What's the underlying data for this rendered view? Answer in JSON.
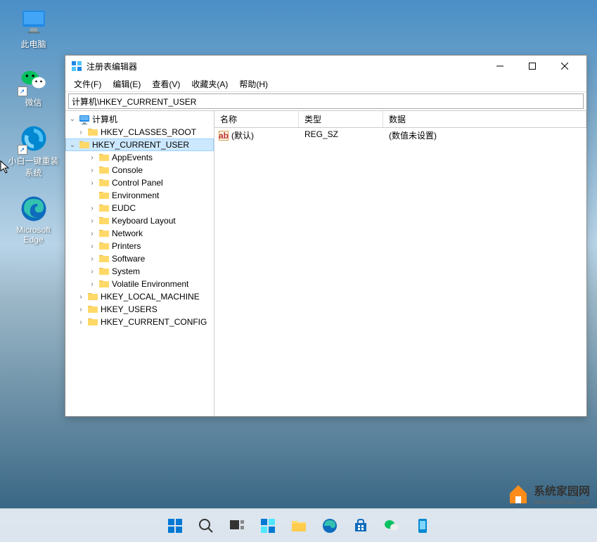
{
  "desktop": {
    "icons": [
      {
        "name": "pc",
        "label": "此电脑"
      },
      {
        "name": "wechat",
        "label": "微信"
      },
      {
        "name": "install",
        "label": "小白一键重装系统"
      },
      {
        "name": "edge",
        "label": "Microsoft Edge"
      }
    ]
  },
  "window": {
    "title": "注册表编辑器",
    "menubar": [
      "文件(F)",
      "编辑(E)",
      "查看(V)",
      "收藏夹(A)",
      "帮助(H)"
    ],
    "address": "计算机\\HKEY_CURRENT_USER",
    "tree": {
      "root": "计算机",
      "hives": [
        {
          "label": "HKEY_CLASSES_ROOT",
          "expanded": false,
          "children": []
        },
        {
          "label": "HKEY_CURRENT_USER",
          "expanded": true,
          "selected": true,
          "children": [
            {
              "label": "AppEvents",
              "hasChildren": true
            },
            {
              "label": "Console",
              "hasChildren": true
            },
            {
              "label": "Control Panel",
              "hasChildren": true
            },
            {
              "label": "Environment",
              "hasChildren": false
            },
            {
              "label": "EUDC",
              "hasChildren": true
            },
            {
              "label": "Keyboard Layout",
              "hasChildren": true
            },
            {
              "label": "Network",
              "hasChildren": true
            },
            {
              "label": "Printers",
              "hasChildren": true
            },
            {
              "label": "Software",
              "hasChildren": true
            },
            {
              "label": "System",
              "hasChildren": true
            },
            {
              "label": "Volatile Environment",
              "hasChildren": true
            }
          ]
        },
        {
          "label": "HKEY_LOCAL_MACHINE",
          "expanded": false,
          "children": []
        },
        {
          "label": "HKEY_USERS",
          "expanded": false,
          "children": []
        },
        {
          "label": "HKEY_CURRENT_CONFIG",
          "expanded": false,
          "children": []
        }
      ]
    },
    "list": {
      "headers": {
        "name": "名称",
        "type": "类型",
        "data": "数据"
      },
      "rows": [
        {
          "name": "(默认)",
          "type": "REG_SZ",
          "data": "(数值未设置)"
        }
      ]
    }
  },
  "watermark": {
    "title": "系统家园网",
    "url": "www.hnzkhbsb.com"
  }
}
